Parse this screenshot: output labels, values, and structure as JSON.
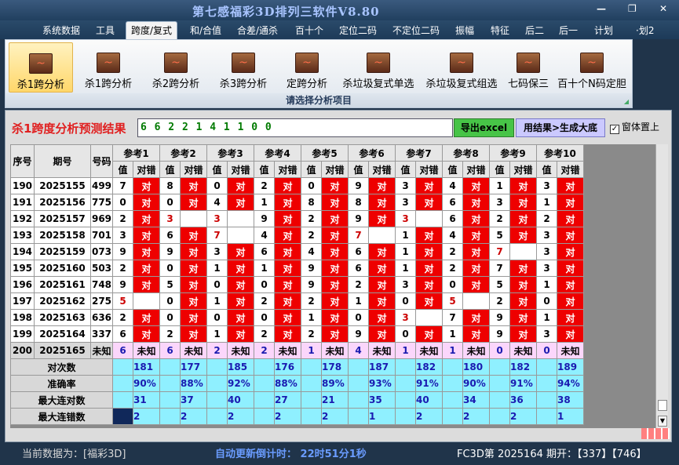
{
  "window": {
    "title": "第七感福彩3D排列三软件V8.80",
    "minimize": "—",
    "restore": "❐",
    "close": "✕"
  },
  "menu": [
    "系统数据",
    "工具",
    "跨度/复式",
    "和/合值",
    "合差/通杀",
    "百十个",
    "定位二码",
    "不定位二码",
    "振幅",
    "特征",
    "后二",
    "后一",
    "计划",
    "·划2"
  ],
  "menu_active": "跨度/复式",
  "ribbon": {
    "buttons": [
      "杀1跨分析",
      "杀1跨分析",
      "杀2跨分析",
      "杀3跨分析",
      "定跨分析",
      "杀垃圾复式单选",
      "杀垃圾复式组选",
      "七码保三",
      "百十个N码定胆"
    ],
    "selected_index": 0,
    "caption": "请选择分析项目",
    "icon": "chart-icon"
  },
  "result": {
    "label": "杀1跨度分析预测结果",
    "value": "6 6 2 2 1 4 1 1 0 0",
    "export_label": "导出excel",
    "generate_label": "用结果>生成大底",
    "ontop_label": "窗体置上",
    "ontop_checked": "✓"
  },
  "table": {
    "col_headers": {
      "seq": "序号",
      "period": "期号",
      "code": "号码",
      "val": "值",
      "hit": "对错"
    },
    "refs": [
      "参考1",
      "参考2",
      "参考3",
      "参考4",
      "参考5",
      "参考6",
      "参考7",
      "参考8",
      "参考9",
      "参考10"
    ],
    "hit_text": "对",
    "rows": [
      {
        "seq": "190",
        "period": "2025155",
        "code": "499",
        "vals": [
          "7",
          "8",
          "0",
          "2",
          "0",
          "9",
          "3",
          "4",
          "1",
          "3"
        ],
        "hit": [
          1,
          1,
          1,
          1,
          1,
          1,
          1,
          1,
          1,
          1
        ]
      },
      {
        "seq": "191",
        "period": "2025156",
        "code": "775",
        "vals": [
          "0",
          "0",
          "4",
          "1",
          "8",
          "8",
          "3",
          "6",
          "3",
          "1"
        ],
        "hit": [
          1,
          1,
          1,
          1,
          1,
          1,
          1,
          1,
          1,
          1
        ]
      },
      {
        "seq": "192",
        "period": "2025157",
        "code": "969",
        "vals": [
          "2",
          "3",
          "3",
          "9",
          "2",
          "9",
          "3",
          "6",
          "2",
          "2"
        ],
        "hit": [
          1,
          0,
          0,
          1,
          1,
          1,
          0,
          1,
          1,
          1
        ]
      },
      {
        "seq": "193",
        "period": "2025158",
        "code": "701",
        "vals": [
          "3",
          "6",
          "7",
          "4",
          "2",
          "7",
          "1",
          "4",
          "5",
          "3"
        ],
        "hit": [
          1,
          1,
          0,
          1,
          1,
          0,
          1,
          1,
          1,
          1
        ]
      },
      {
        "seq": "194",
        "period": "2025159",
        "code": "073",
        "vals": [
          "9",
          "9",
          "3",
          "6",
          "4",
          "6",
          "1",
          "2",
          "7",
          "3"
        ],
        "hit": [
          1,
          1,
          1,
          1,
          1,
          1,
          1,
          1,
          0,
          1
        ]
      },
      {
        "seq": "195",
        "period": "2025160",
        "code": "503",
        "vals": [
          "2",
          "0",
          "1",
          "1",
          "9",
          "6",
          "1",
          "2",
          "7",
          "3"
        ],
        "hit": [
          1,
          1,
          1,
          1,
          1,
          1,
          1,
          1,
          1,
          1
        ]
      },
      {
        "seq": "196",
        "period": "2025161",
        "code": "748",
        "vals": [
          "9",
          "5",
          "0",
          "0",
          "9",
          "2",
          "3",
          "0",
          "5",
          "1"
        ],
        "hit": [
          1,
          1,
          1,
          1,
          1,
          1,
          1,
          1,
          1,
          1
        ]
      },
      {
        "seq": "197",
        "period": "2025162",
        "code": "275",
        "vals": [
          "5",
          "0",
          "1",
          "2",
          "2",
          "1",
          "0",
          "5",
          "2",
          "0"
        ],
        "hit": [
          0,
          1,
          1,
          1,
          1,
          1,
          1,
          0,
          1,
          1
        ]
      },
      {
        "seq": "198",
        "period": "2025163",
        "code": "636",
        "vals": [
          "2",
          "0",
          "0",
          "0",
          "1",
          "0",
          "3",
          "7",
          "9",
          "1"
        ],
        "hit": [
          1,
          1,
          1,
          1,
          1,
          1,
          0,
          1,
          1,
          1
        ]
      },
      {
        "seq": "199",
        "period": "2025164",
        "code": "337",
        "vals": [
          "6",
          "2",
          "1",
          "2",
          "2",
          "9",
          "0",
          "1",
          "9",
          "3"
        ],
        "hit": [
          1,
          1,
          1,
          1,
          1,
          1,
          1,
          1,
          1,
          1
        ]
      }
    ],
    "pending": {
      "seq": "200",
      "period": "2025165",
      "code": "未知",
      "vals": [
        "6",
        "6",
        "2",
        "2",
        "1",
        "4",
        "1",
        "1",
        "0",
        "0"
      ],
      "unknown": "未知"
    },
    "stats": [
      {
        "label": "对次数",
        "values": [
          "181",
          "177",
          "185",
          "176",
          "178",
          "187",
          "182",
          "180",
          "182",
          "189"
        ]
      },
      {
        "label": "准确率",
        "values": [
          "90%",
          "88%",
          "92%",
          "88%",
          "89%",
          "93%",
          "91%",
          "90%",
          "91%",
          "94%"
        ]
      },
      {
        "label": "最大连对数",
        "values": [
          "31",
          "37",
          "40",
          "27",
          "21",
          "35",
          "40",
          "34",
          "36",
          "38"
        ]
      },
      {
        "label": "最大连错数",
        "values": [
          "2",
          "2",
          "2",
          "2",
          "2",
          "1",
          "2",
          "2",
          "2",
          "1"
        ]
      }
    ]
  },
  "status": {
    "current": "当前数据为：[福彩3D]",
    "countdown": "自动更新倒计时：  22时51分1秒",
    "issue": "FC3D第 2025164 期开：【337】【746】"
  }
}
